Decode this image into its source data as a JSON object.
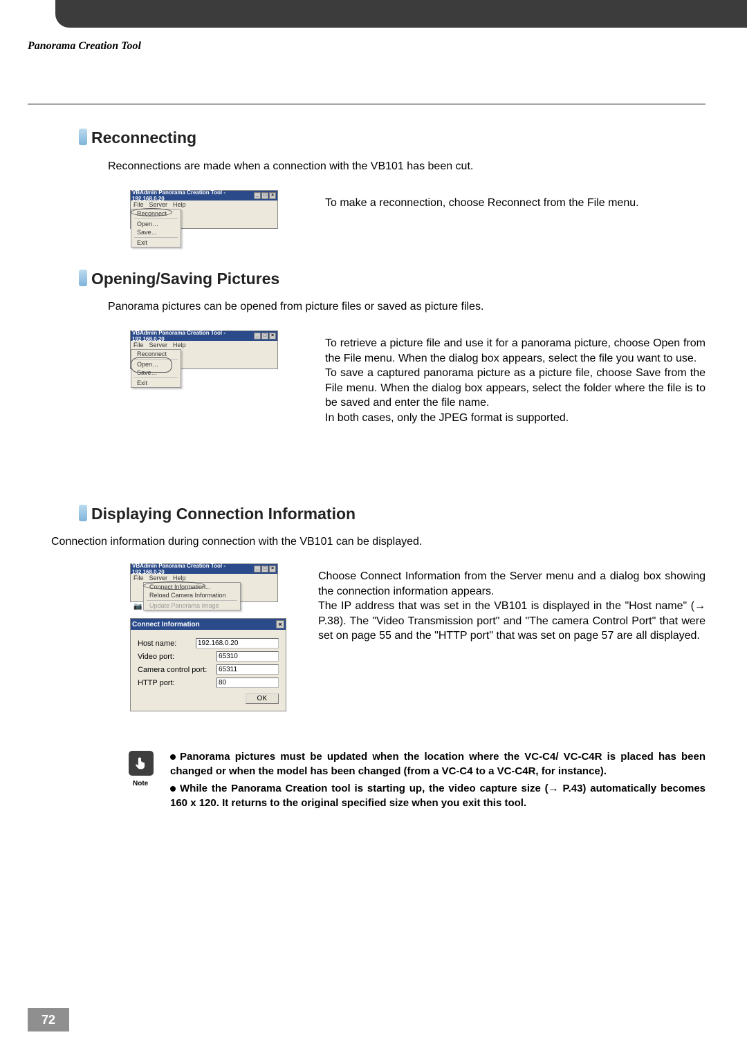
{
  "header": {
    "title": "Panorama Creation Tool"
  },
  "sections": {
    "reconnect": {
      "heading": "Reconnecting",
      "intro": "Reconnections are made when a connection with the VB101 has been cut.",
      "explain": "To make a reconnection, choose Reconnect from the File menu."
    },
    "opensave": {
      "heading": "Opening/Saving Pictures",
      "intro": "Panorama pictures can be opened from picture files or saved as picture files.",
      "explain": "To retrieve a picture file and use it for a panorama picture, choose Open from the File menu. When the dialog box appears, select the file you want to use.\nTo save a captured panorama picture as a picture file, choose Save from the File menu. When the dialog box appears, select the folder where the file is to be saved and enter the file name.\nIn both cases, only the JPEG format is supported."
    },
    "connect": {
      "heading": "Displaying Connection Information",
      "intro": "Connection information during connection with the VB101 can be displayed.",
      "explain": "Choose Connect Information from the Server menu and a dialog box showing the connection information appears.\nThe IP address that was set in the VB101 is displayed in the \"Host name\" (→ P.38). The \"Video Transmission port\" and \"The camera Control Port\" that were set on page 55 and the \"HTTP port\" that was set on page 57 are all displayed."
    }
  },
  "screenshot": {
    "title": "VBAdmin Panorama Creation Tool - 192.168.0.20",
    "menus": {
      "file": "File",
      "server": "Server",
      "help": "Help"
    },
    "file_items": {
      "reconnect": "Reconnect",
      "open": "Open…",
      "save": "Save…",
      "exit": "Exit"
    },
    "server_items": {
      "connect_info": "Connect Information...",
      "reload": "Reload Camera Information",
      "update": "Update Panorama Image"
    },
    "win_buttons": {
      "min": "_",
      "max": "□",
      "close": "×"
    },
    "camera_icon": "📷"
  },
  "dialog": {
    "title": "Connect Information",
    "host_label": "Host name:",
    "host_value": "192.168.0.20",
    "video_label": "Video port:",
    "video_value": "65310",
    "camera_label": "Camera control port:",
    "camera_value": "65311",
    "http_label": "HTTP port:",
    "http_value": "80",
    "ok": "OK",
    "close": "×"
  },
  "note": {
    "label": "Note",
    "bullet1": "Panorama pictures must be updated when the location where the VC-C4/ VC-C4R is placed has been changed or when the model has been changed (from a VC-C4 to a VC-C4R, for instance).",
    "bullet2": "While the Panorama Creation tool is starting up, the video capture size (→ P.43) automatically becomes 160 x 120. It returns to the original specified size when you exit this tool."
  },
  "page_number": "72"
}
